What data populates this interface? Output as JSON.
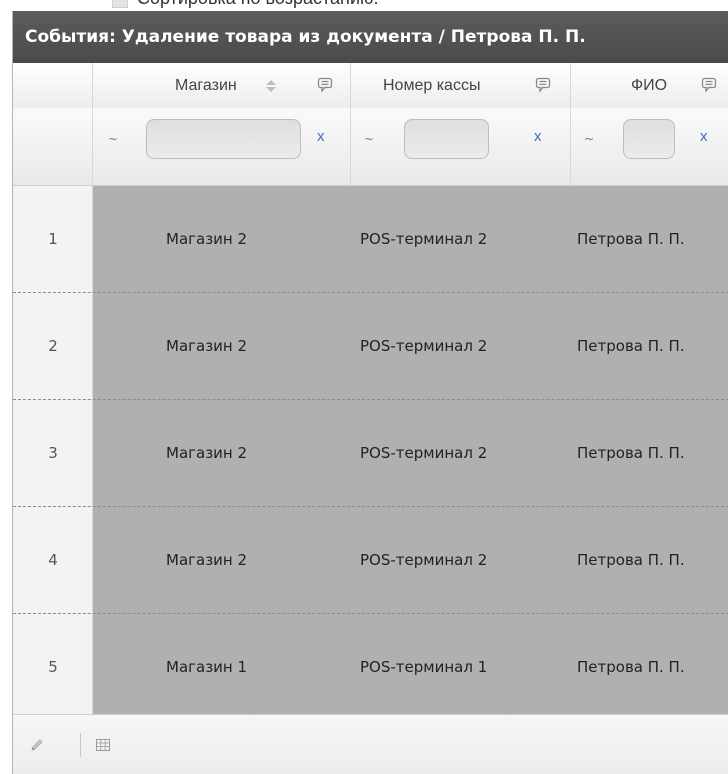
{
  "caption": {
    "text": "Сортировка по возрастанию."
  },
  "grid": {
    "title": "События: Удаление товара из документа / Петрова П. П.",
    "columns": [
      {
        "label": "Магазин"
      },
      {
        "label": "Номер кассы"
      },
      {
        "label": "ФИО"
      }
    ],
    "filters": {
      "tilde": "~",
      "clear_label": "x",
      "values": [
        "",
        "",
        ""
      ]
    },
    "rows": [
      {
        "num": "1",
        "store": "Магазин 2",
        "register": "POS-терминал 2",
        "name": "Петрова П. П."
      },
      {
        "num": "2",
        "store": "Магазин 2",
        "register": "POS-терминал 2",
        "name": "Петрова П. П."
      },
      {
        "num": "3",
        "store": "Магазин 2",
        "register": "POS-терминал 2",
        "name": "Петрова П. П."
      },
      {
        "num": "4",
        "store": "Магазин 2",
        "register": "POS-терминал 2",
        "name": "Петрова П. П."
      },
      {
        "num": "5",
        "store": "Магазин 1",
        "register": "POS-терминал 1",
        "name": "Петрова П. П."
      }
    ],
    "footer": {
      "icons": [
        "pencil-icon",
        "grid-icon"
      ]
    }
  },
  "colors": {
    "title_bar": "#4f4f4f",
    "row_bg": "#b0b0b0",
    "clear_x": "#3b6fc2"
  }
}
